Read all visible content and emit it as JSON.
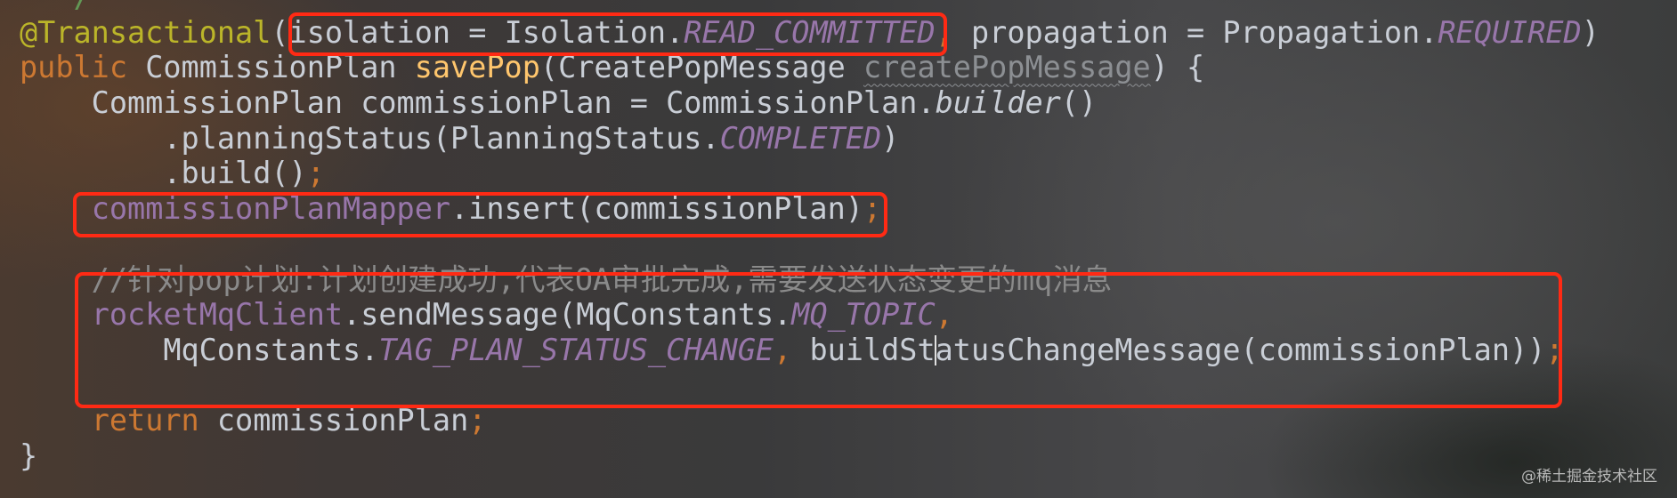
{
  "code_lines": [
    [
      {
        "t": "  */",
        "c": "cmg"
      }
    ],
    [
      {
        "t": "@Transactional",
        "c": "ann"
      },
      {
        "t": "(isolation = Isolation.",
        "c": ""
      },
      {
        "t": "READ_COMMITTED",
        "c": "cst"
      },
      {
        "t": ", ",
        "c": "kw"
      },
      {
        "t": "propagation = Propagation.",
        "c": ""
      },
      {
        "t": "REQUIRED",
        "c": "cst"
      },
      {
        "t": ")",
        "c": ""
      }
    ],
    [
      {
        "t": "public ",
        "c": "kw"
      },
      {
        "t": "CommissionPlan ",
        "c": ""
      },
      {
        "t": "savePop",
        "c": "fn"
      },
      {
        "t": "(CreatePopMessage ",
        "c": ""
      },
      {
        "t": "createPopMessage",
        "c": "par"
      },
      {
        "t": ") {",
        "c": ""
      }
    ],
    [
      {
        "t": "    CommissionPlan commissionPlan = CommissionPlan.",
        "c": ""
      },
      {
        "t": "builder",
        "c": "it"
      },
      {
        "t": "()",
        "c": ""
      }
    ],
    [
      {
        "t": "        .planningStatus(PlanningStatus.",
        "c": ""
      },
      {
        "t": "COMPLETED",
        "c": "cst"
      },
      {
        "t": ")",
        "c": ""
      }
    ],
    [
      {
        "t": "        .build()",
        "c": ""
      },
      {
        "t": ";",
        "c": "kw"
      }
    ],
    [
      {
        "t": "    ",
        "c": ""
      },
      {
        "t": "commissionPlanMapper",
        "c": "fld"
      },
      {
        "t": ".insert(commissionPlan)",
        "c": ""
      },
      {
        "t": ";",
        "c": "kw"
      }
    ],
    [],
    [
      {
        "t": "    //针对pop计划:计划创建成功,代表OA审批完成,需要发送状态变更的mq消息",
        "c": "cm"
      }
    ],
    [
      {
        "t": "    ",
        "c": ""
      },
      {
        "t": "rocketMqClient",
        "c": "fld"
      },
      {
        "t": ".sendMessage(MqConstants.",
        "c": ""
      },
      {
        "t": "MQ_TOPIC",
        "c": "cst"
      },
      {
        "t": ",",
        "c": "kw"
      }
    ],
    [
      {
        "t": "        MqConstants.",
        "c": ""
      },
      {
        "t": "TAG_PLAN_STATUS_CHANGE",
        "c": "cst"
      },
      {
        "t": ", ",
        "c": "kw"
      },
      {
        "t": "buildSt",
        "c": ""
      },
      {
        "t": "",
        "c": "caret"
      },
      {
        "t": "atusChangeMessage(commissionPlan))",
        "c": ""
      },
      {
        "t": ";",
        "c": "kw"
      }
    ],
    [],
    [
      {
        "t": "    ",
        "c": ""
      },
      {
        "t": "return ",
        "c": "kw"
      },
      {
        "t": "commissionPlan",
        "c": ""
      },
      {
        "t": ";",
        "c": "kw"
      }
    ],
    [
      {
        "t": "}",
        "c": ""
      }
    ]
  ],
  "highlight_color": "#ff2a14",
  "watermark": "@稀土掘金技术社区"
}
